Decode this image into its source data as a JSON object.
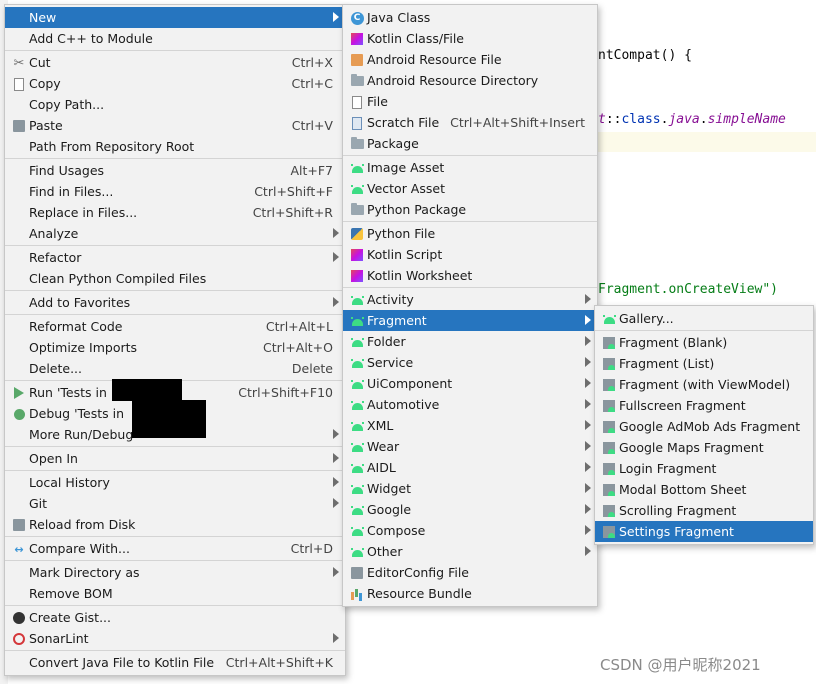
{
  "editor": {
    "lines": [
      "ntCompat() {",
      "t::class.java.simpleName",
      "Fragment.onCreateView\")"
    ]
  },
  "menu_main": {
    "items": [
      {
        "label": "New",
        "shortcut": "",
        "submenu": true,
        "icon": "none",
        "selected": true
      },
      {
        "label": "Add C++ to Module",
        "shortcut": "",
        "submenu": false,
        "icon": "none"
      },
      {
        "sep": true
      },
      {
        "label": "Cut",
        "shortcut": "Ctrl+X",
        "submenu": false,
        "icon": "scissors-icon"
      },
      {
        "label": "Copy",
        "shortcut": "Ctrl+C",
        "submenu": false,
        "icon": "copy-icon"
      },
      {
        "label": "Copy Path...",
        "shortcut": "",
        "submenu": false,
        "icon": "none"
      },
      {
        "label": "Paste",
        "shortcut": "Ctrl+V",
        "submenu": false,
        "icon": "clipboard-icon"
      },
      {
        "label": "Path From Repository Root",
        "shortcut": "",
        "submenu": false,
        "icon": "none"
      },
      {
        "sep": true
      },
      {
        "label": "Find Usages",
        "shortcut": "Alt+F7",
        "submenu": false,
        "icon": "none"
      },
      {
        "label": "Find in Files...",
        "shortcut": "Ctrl+Shift+F",
        "submenu": false,
        "icon": "none"
      },
      {
        "label": "Replace in Files...",
        "shortcut": "Ctrl+Shift+R",
        "submenu": false,
        "icon": "none"
      },
      {
        "label": "Analyze",
        "shortcut": "",
        "submenu": true,
        "icon": "none"
      },
      {
        "sep": true
      },
      {
        "label": "Refactor",
        "shortcut": "",
        "submenu": true,
        "icon": "none"
      },
      {
        "label": "Clean Python Compiled Files",
        "shortcut": "",
        "submenu": false,
        "icon": "none"
      },
      {
        "sep": true
      },
      {
        "label": "Add to Favorites",
        "shortcut": "",
        "submenu": true,
        "icon": "none"
      },
      {
        "sep": true
      },
      {
        "label": "Reformat Code",
        "shortcut": "Ctrl+Alt+L",
        "submenu": false,
        "icon": "none"
      },
      {
        "label": "Optimize Imports",
        "shortcut": "Ctrl+Alt+O",
        "submenu": false,
        "icon": "none"
      },
      {
        "label": "Delete...",
        "shortcut": "Delete",
        "submenu": false,
        "icon": "none"
      },
      {
        "sep": true
      },
      {
        "label": "Run 'Tests in 'c",
        "shortcut": "Ctrl+Shift+F10",
        "submenu": false,
        "icon": "run-icon"
      },
      {
        "label": "Debug 'Tests in",
        "shortcut": "",
        "submenu": false,
        "icon": "debug-icon"
      },
      {
        "label": "More Run/Debug",
        "shortcut": "",
        "submenu": true,
        "icon": "none"
      },
      {
        "sep": true
      },
      {
        "label": "Open In",
        "shortcut": "",
        "submenu": true,
        "icon": "none"
      },
      {
        "sep": true
      },
      {
        "label": "Local History",
        "shortcut": "",
        "submenu": true,
        "icon": "none"
      },
      {
        "label": "Git",
        "shortcut": "",
        "submenu": true,
        "icon": "none"
      },
      {
        "label": "Reload from Disk",
        "shortcut": "",
        "submenu": false,
        "icon": "reload-icon"
      },
      {
        "sep": true
      },
      {
        "label": "Compare With...",
        "shortcut": "Ctrl+D",
        "submenu": false,
        "icon": "compare-icon"
      },
      {
        "sep": true
      },
      {
        "label": "Mark Directory as",
        "shortcut": "",
        "submenu": true,
        "icon": "none"
      },
      {
        "label": "Remove BOM",
        "shortcut": "",
        "submenu": false,
        "icon": "none"
      },
      {
        "sep": true
      },
      {
        "label": "Create Gist...",
        "shortcut": "",
        "submenu": false,
        "icon": "github-icon"
      },
      {
        "label": "SonarLint",
        "shortcut": "",
        "submenu": true,
        "icon": "sonarlint-icon"
      },
      {
        "sep": true
      },
      {
        "label": "Convert Java File to Kotlin File",
        "shortcut": "Ctrl+Alt+Shift+K",
        "submenu": false,
        "icon": "none"
      }
    ]
  },
  "menu_new": {
    "items": [
      {
        "label": "Java Class",
        "shortcut": "",
        "submenu": false,
        "icon": "java-class-icon"
      },
      {
        "label": "Kotlin Class/File",
        "shortcut": "",
        "submenu": false,
        "icon": "kotlin-file-icon"
      },
      {
        "label": "Android Resource File",
        "shortcut": "",
        "submenu": false,
        "icon": "android-resource-file-icon"
      },
      {
        "label": "Android Resource Directory",
        "shortcut": "",
        "submenu": false,
        "icon": "folder-icon"
      },
      {
        "label": "File",
        "shortcut": "",
        "submenu": false,
        "icon": "file-icon"
      },
      {
        "label": "Scratch File",
        "shortcut": "Ctrl+Alt+Shift+Insert",
        "submenu": false,
        "icon": "scratch-file-icon"
      },
      {
        "label": "Package",
        "shortcut": "",
        "submenu": false,
        "icon": "package-icon"
      },
      {
        "sep": true
      },
      {
        "label": "Image Asset",
        "shortcut": "",
        "submenu": false,
        "icon": "android-icon"
      },
      {
        "label": "Vector Asset",
        "shortcut": "",
        "submenu": false,
        "icon": "android-icon"
      },
      {
        "label": "Python Package",
        "shortcut": "",
        "submenu": false,
        "icon": "package-icon"
      },
      {
        "sep": true
      },
      {
        "label": "Python File",
        "shortcut": "",
        "submenu": false,
        "icon": "python-file-icon"
      },
      {
        "label": "Kotlin Script",
        "shortcut": "",
        "submenu": false,
        "icon": "kotlin-script-icon"
      },
      {
        "label": "Kotlin Worksheet",
        "shortcut": "",
        "submenu": false,
        "icon": "kotlin-worksheet-icon"
      },
      {
        "sep": true
      },
      {
        "label": "Activity",
        "shortcut": "",
        "submenu": true,
        "icon": "android-icon"
      },
      {
        "label": "Fragment",
        "shortcut": "",
        "submenu": true,
        "icon": "android-icon",
        "selected": true
      },
      {
        "label": "Folder",
        "shortcut": "",
        "submenu": true,
        "icon": "android-icon"
      },
      {
        "label": "Service",
        "shortcut": "",
        "submenu": true,
        "icon": "android-icon"
      },
      {
        "label": "UiComponent",
        "shortcut": "",
        "submenu": true,
        "icon": "android-icon"
      },
      {
        "label": "Automotive",
        "shortcut": "",
        "submenu": true,
        "icon": "android-icon"
      },
      {
        "label": "XML",
        "shortcut": "",
        "submenu": true,
        "icon": "android-icon"
      },
      {
        "label": "Wear",
        "shortcut": "",
        "submenu": true,
        "icon": "android-icon"
      },
      {
        "label": "AIDL",
        "shortcut": "",
        "submenu": true,
        "icon": "android-icon"
      },
      {
        "label": "Widget",
        "shortcut": "",
        "submenu": true,
        "icon": "android-icon"
      },
      {
        "label": "Google",
        "shortcut": "",
        "submenu": true,
        "icon": "android-icon"
      },
      {
        "label": "Compose",
        "shortcut": "",
        "submenu": true,
        "icon": "android-icon"
      },
      {
        "label": "Other",
        "shortcut": "",
        "submenu": true,
        "icon": "android-icon"
      },
      {
        "label": "EditorConfig File",
        "shortcut": "",
        "submenu": false,
        "icon": "gear-icon"
      },
      {
        "label": "Resource Bundle",
        "shortcut": "",
        "submenu": false,
        "icon": "resource-bundle-icon"
      }
    ]
  },
  "menu_fragment": {
    "items": [
      {
        "label": "Gallery...",
        "icon": "android-icon"
      },
      {
        "sep": true
      },
      {
        "label": "Fragment (Blank)",
        "icon": "fragment-template-icon"
      },
      {
        "label": "Fragment (List)",
        "icon": "fragment-template-icon"
      },
      {
        "label": "Fragment (with ViewModel)",
        "icon": "fragment-template-icon"
      },
      {
        "label": "Fullscreen Fragment",
        "icon": "fragment-template-icon"
      },
      {
        "label": "Google AdMob Ads Fragment",
        "icon": "fragment-template-icon"
      },
      {
        "label": "Google Maps Fragment",
        "icon": "fragment-template-icon"
      },
      {
        "label": "Login Fragment",
        "icon": "fragment-template-icon"
      },
      {
        "label": "Modal Bottom Sheet",
        "icon": "fragment-template-icon"
      },
      {
        "label": "Scrolling Fragment",
        "icon": "fragment-template-icon"
      },
      {
        "label": "Settings Fragment",
        "icon": "fragment-template-icon",
        "selected": true
      }
    ]
  },
  "watermark": "CSDN @用户昵称2021",
  "colors": {
    "selection": "#2675bf",
    "menu_bg": "#f2f2f2",
    "android_green": "#3ddc84"
  }
}
